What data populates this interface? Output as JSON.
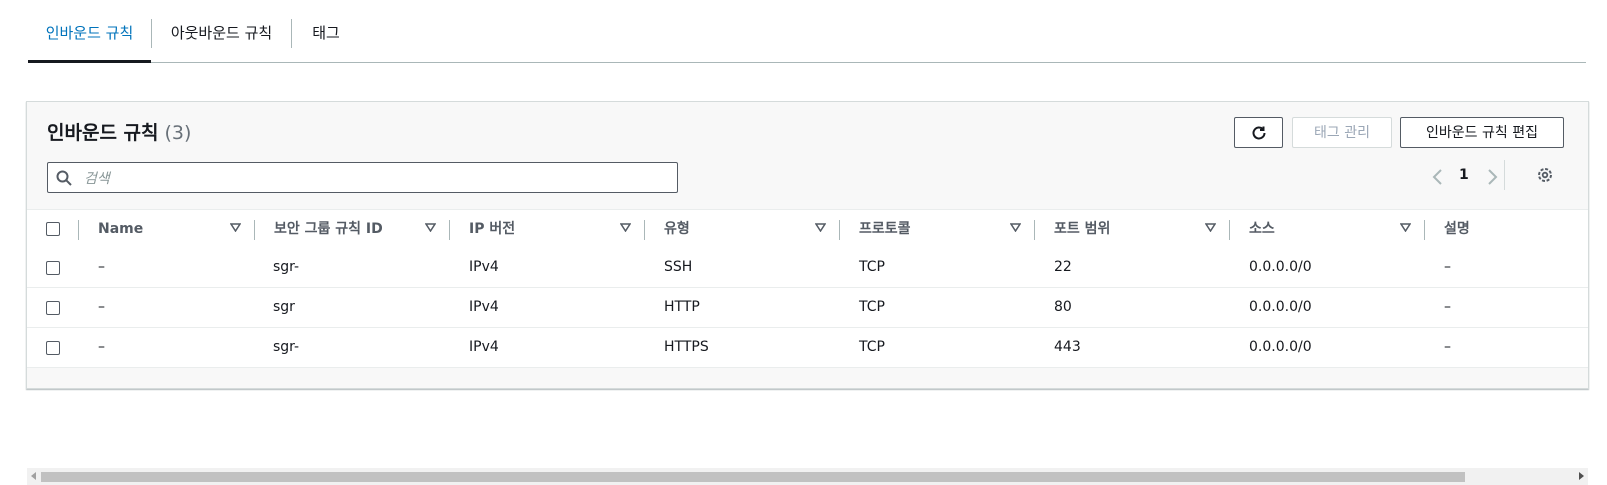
{
  "tabs": [
    {
      "label": "인바운드 규칙",
      "active": true
    },
    {
      "label": "아웃바운드 규칙",
      "active": false
    },
    {
      "label": "태그",
      "active": false
    }
  ],
  "panel": {
    "title": "인바운드 규칙",
    "count": "(3)",
    "buttons": {
      "refresh_icon": "refresh-icon",
      "manage_tags": "태그 관리",
      "edit_rules": "인바운드 규칙 편집"
    },
    "search": {
      "placeholder": "검색",
      "value": ""
    },
    "pagination": {
      "current_page": "1"
    }
  },
  "table": {
    "columns": [
      "Name",
      "보안 그룹 규칙 ID",
      "IP 버전",
      "유형",
      "프로토콜",
      "포트 범위",
      "소스",
      "설명"
    ],
    "rows": [
      {
        "name": "–",
        "rule_id": "sgr-",
        "ip_version": "IPv4",
        "type": "SSH",
        "protocol": "TCP",
        "port_range": "22",
        "source": "0.0.0.0/0",
        "description": "–"
      },
      {
        "name": "–",
        "rule_id": "sgr",
        "ip_version": "IPv4",
        "type": "HTTP",
        "protocol": "TCP",
        "port_range": "80",
        "source": "0.0.0.0/0",
        "description": "–"
      },
      {
        "name": "–",
        "rule_id": "sgr-",
        "ip_version": "IPv4",
        "type": "HTTPS",
        "protocol": "TCP",
        "port_range": "443",
        "source": "0.0.0.0/0",
        "description": "–"
      }
    ]
  },
  "colors": {
    "accent": "#0073bb",
    "border": "#aab7b8",
    "text": "#16191f"
  }
}
